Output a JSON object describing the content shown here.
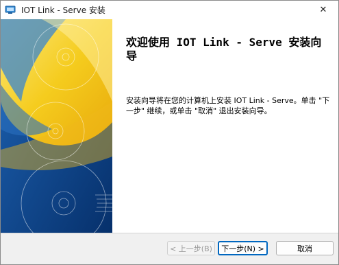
{
  "window": {
    "title": "IOT Link - Serve 安装",
    "close_glyph": "✕"
  },
  "content": {
    "heading": "欢迎使用 IOT Link - Serve 安装向导",
    "description": "安装向导将在您的计算机上安装 IOT Link - Serve。单击 \"下一步\" 继续，或单击 \"取消\" 退出安装向导。"
  },
  "buttons": {
    "back": "< 上一步(B)",
    "next": "下一步(N) >",
    "cancel": "取消"
  },
  "colors": {
    "banner_blue": "#0b3f86",
    "banner_yellow": "#f2c40f",
    "focus_blue": "#0067c0"
  }
}
